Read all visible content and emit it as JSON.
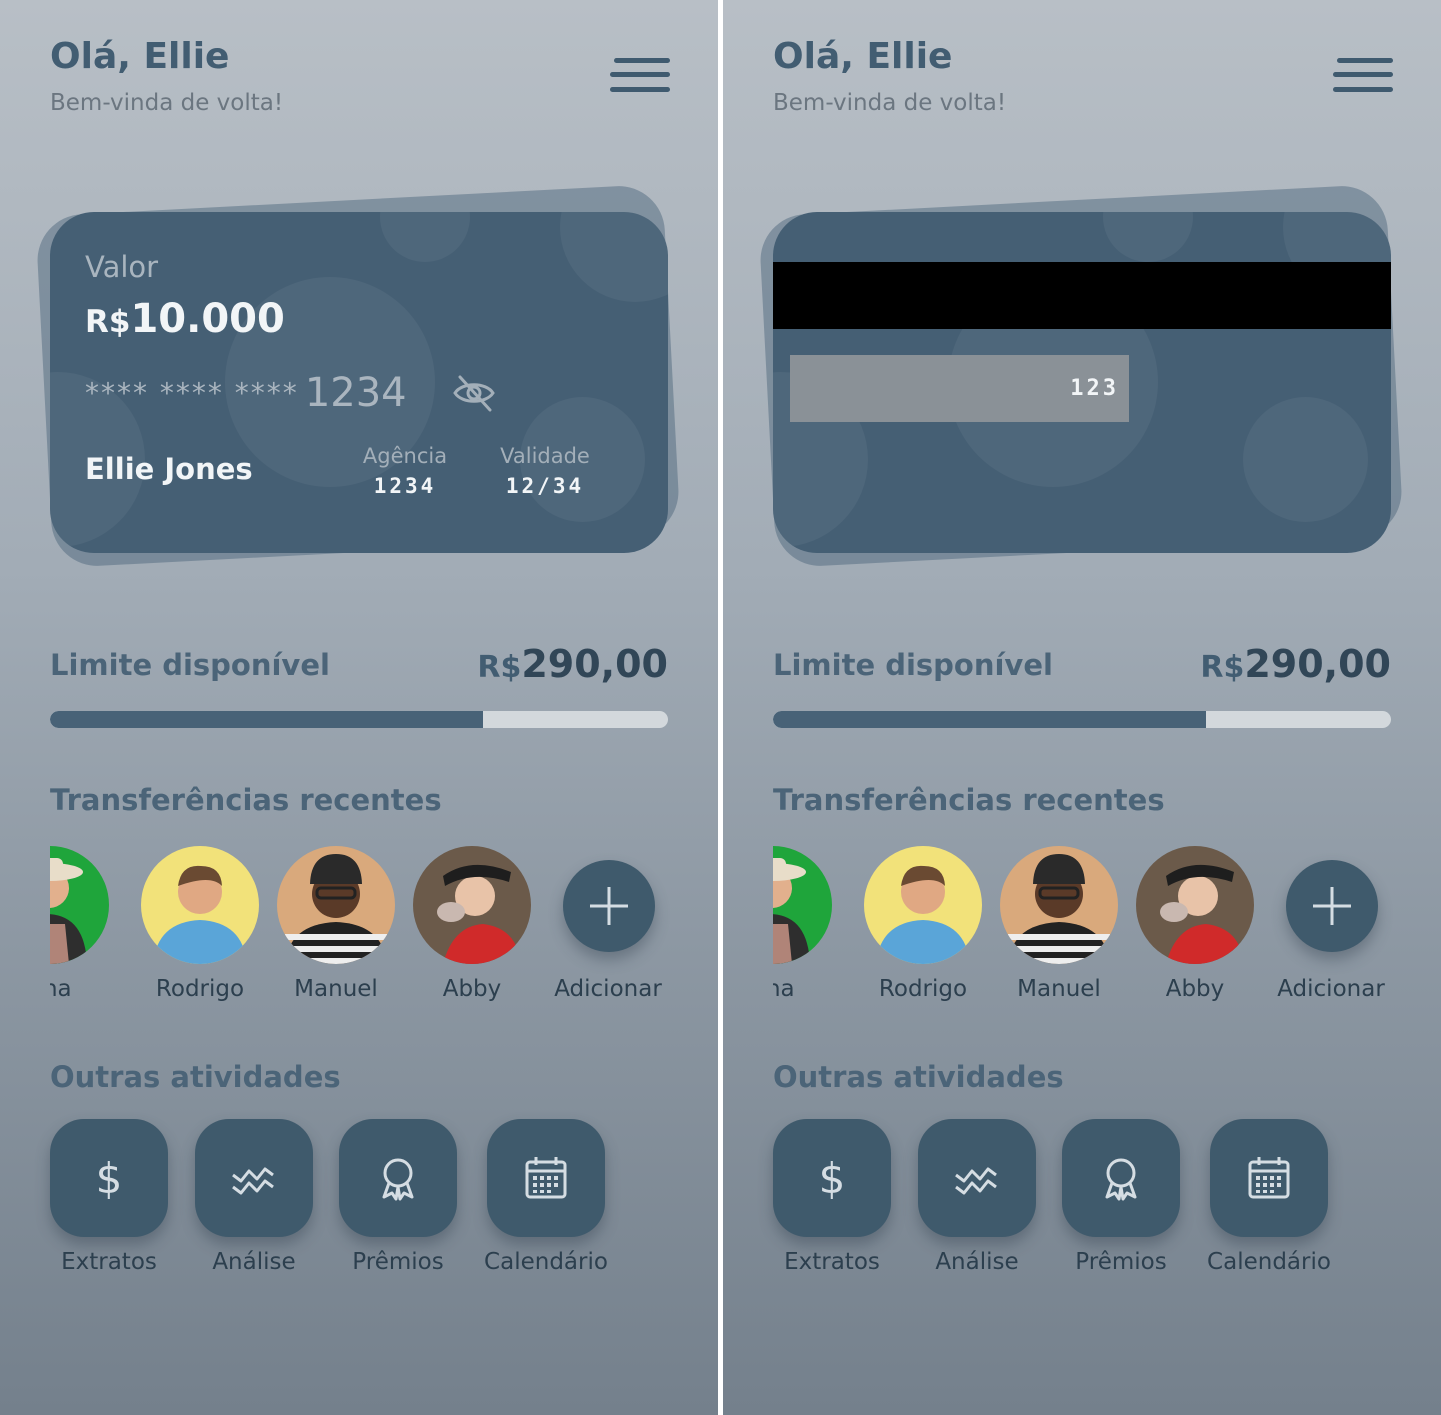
{
  "header": {
    "greeting": "Olá, Ellie",
    "subtitle": "Bem-vinda de volta!"
  },
  "card": {
    "label": "Valor",
    "currency": "R$",
    "amount": "10.000",
    "masked": "**** **** ****",
    "last4": "1234",
    "holder": "Ellie Jones",
    "agency_label": "Agência",
    "agency": "1234",
    "validity_label": "Validade",
    "validity": "12/34",
    "cvv": "123"
  },
  "limit": {
    "label": "Limite disponível",
    "currency": "R$",
    "amount": "290,00",
    "used_fraction": 0.7
  },
  "transfers": {
    "title": "Transferências recentes",
    "contacts": [
      {
        "name": "Anna",
        "visible_name": "nna"
      },
      {
        "name": "Rodrigo"
      },
      {
        "name": "Manuel"
      },
      {
        "name": "Abby"
      }
    ],
    "add_label": "Adicionar"
  },
  "activities": {
    "title": "Outras atividades",
    "items": [
      {
        "label": "Extratos",
        "icon": "dollar-icon"
      },
      {
        "label": "Análise",
        "icon": "chart-wave-icon"
      },
      {
        "label": "Prêmios",
        "icon": "award-icon"
      },
      {
        "label": "Calendário",
        "icon": "calendar-icon"
      }
    ]
  },
  "colors": {
    "primary": "#455f74",
    "tile": "#3f5a6c",
    "accent_text": "#4b6478"
  }
}
